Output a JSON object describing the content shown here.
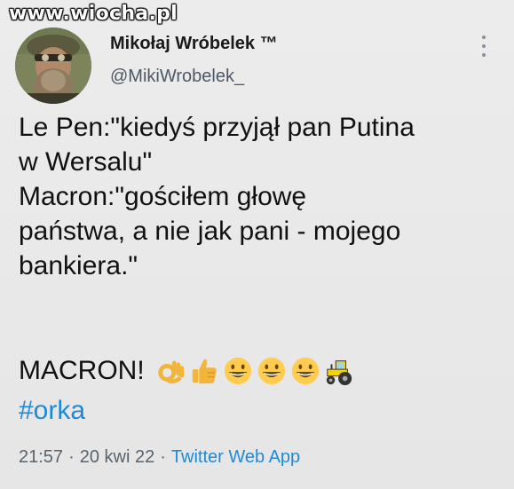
{
  "watermark": "www.wiocha.pl",
  "author": {
    "name": "Mikołaj Wróbelek ™",
    "handle": "@MikiWrobelek_"
  },
  "tweet": {
    "lines": [
      "Le Pen:\"kiedyś przyjął pan Putina",
      "w Wersalu\"",
      "Macron:\"gościłem głowę",
      "państwa, a nie jak pani - mojego",
      "bankiera.\""
    ],
    "exclamation": "MACRON!",
    "emojis": [
      "ok-hand-emoji",
      "thumbs-up-emoji",
      "grinning-face-emoji",
      "grinning-face-emoji",
      "grinning-face-emoji",
      "tractor-emoji"
    ],
    "hashtag": "#orka"
  },
  "meta": {
    "time": "21:57",
    "separator": "·",
    "date": "20 kwi 22",
    "app": "Twitter Web App"
  },
  "colors": {
    "link": "#1d8ad6",
    "text": "#111111",
    "muted": "#59636d"
  }
}
